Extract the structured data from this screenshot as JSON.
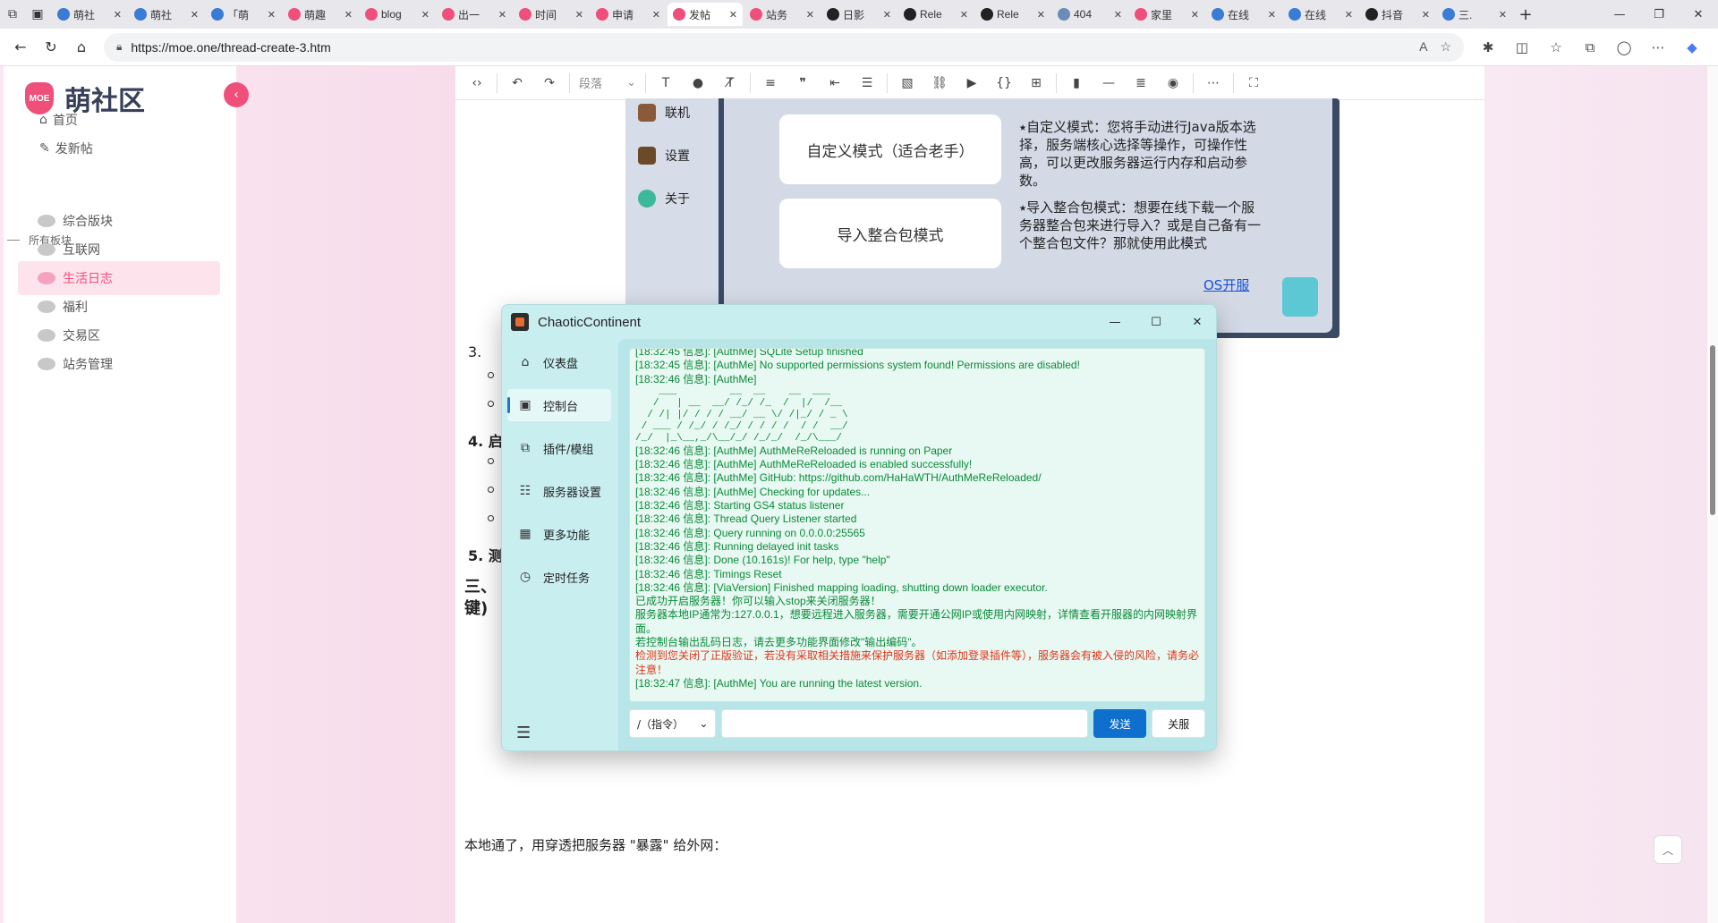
{
  "browser": {
    "tabs": [
      {
        "label": "萌社",
        "color": "#3a7bd5"
      },
      {
        "label": "萌社",
        "color": "#3a7bd5"
      },
      {
        "label": "「萌",
        "color": "#3a7bd5"
      },
      {
        "label": "萌趣",
        "color": "#ef4f7b"
      },
      {
        "label": "blog",
        "color": "#ef4f7b"
      },
      {
        "label": "出一",
        "color": "#ef4f7b"
      },
      {
        "label": "时间",
        "color": "#ef4f7b"
      },
      {
        "label": "申请",
        "color": "#ef4f7b"
      },
      {
        "label": "发帖",
        "color": "#ef4f7b",
        "active": true
      },
      {
        "label": "站务",
        "color": "#ef4f7b"
      },
      {
        "label": "日影",
        "color": "#222222"
      },
      {
        "label": "Rele",
        "color": "#222222"
      },
      {
        "label": "Rele",
        "color": "#222222"
      },
      {
        "label": "404",
        "color": "#6b8cb8"
      },
      {
        "label": "家里",
        "color": "#ef4f7b"
      },
      {
        "label": "在线",
        "color": "#3a7bd5"
      },
      {
        "label": "在线",
        "color": "#3a7bd5"
      },
      {
        "label": "抖音",
        "color": "#222222"
      },
      {
        "label": "三.",
        "color": "#3a7bd5"
      }
    ],
    "url": "https://moe.one/thread-create-3.htm"
  },
  "sidebar": {
    "brand": "萌社区",
    "logo_text": "MOE",
    "links": [
      {
        "label": "首页"
      },
      {
        "label": "发新帖"
      }
    ],
    "section_title": "所有板块",
    "boards": [
      {
        "label": "综合版块"
      },
      {
        "label": "互联网"
      },
      {
        "label": "生活日志",
        "active": true
      },
      {
        "label": "福利"
      },
      {
        "label": "交易区"
      },
      {
        "label": "站务管理"
      }
    ]
  },
  "editor": {
    "toolbar": {
      "paragraph_select": "段落"
    },
    "embed": {
      "nav": [
        "联机",
        "设置",
        "关于"
      ],
      "cards": [
        "自定义模式（适合老手）",
        "导入整合包模式"
      ],
      "desc1": "⭑自定义模式：您将手动进行Java版本选择，服务端核心选择等操作，可操作性高，可以更改服务器运行内存和启动参数。",
      "desc2": "⭑导入整合包模式：想要在线下载一个服务器整合包来进行导入？或是自己备有一个整合包文件？那就使用此模式",
      "link": "OS开服"
    },
    "list_items": [
      "3.",
      "4. 启",
      "5. 测"
    ],
    "heading_fragment_1": "三、",
    "heading_fragment_2": "键)",
    "bottom_text": "本地通了，用穿透把服务器 \"暴露\" 给外网："
  },
  "app": {
    "title": "ChaoticContinent",
    "nav": [
      {
        "label": "仪表盘",
        "icon": "home-icon"
      },
      {
        "label": "控制台",
        "icon": "console-icon",
        "active": true
      },
      {
        "label": "插件/模组",
        "icon": "plugin-icon"
      },
      {
        "label": "服务器设置",
        "icon": "sliders-icon"
      },
      {
        "label": "更多功能",
        "icon": "grid-icon"
      },
      {
        "label": "定时任务",
        "icon": "timer-icon"
      }
    ],
    "console_lines": [
      {
        "t": "[18:32:45 信息]: [AuthMe] SQLite Setup finished",
        "c": "g",
        "cut": true
      },
      {
        "t": "[18:32:45 信息]: [AuthMe] No supported permissions system found! Permissions are disabled!",
        "c": "g"
      },
      {
        "t": "[18:32:46 信息]: [AuthMe]",
        "c": "g"
      },
      {
        "t": "",
        "c": "g"
      },
      {
        "t": "    ___         __  __    __  ___     ",
        "c": "ascii"
      },
      {
        "t": "   /   | __  __/ /_/ /_  /  |/  /__   ",
        "c": "ascii"
      },
      {
        "t": "  / /| |/ / / / __/ __ \\/ /|_/ / _ \\  ",
        "c": "ascii"
      },
      {
        "t": " / ___ / /_/ / /_/ / / / /  / /  __/  ",
        "c": "ascii"
      },
      {
        "t": "/_/  |_\\__,_/\\__/_/ /_/_/  /_/\\___/   ",
        "c": "ascii"
      },
      {
        "t": "[18:32:46 信息]: [AuthMe] AuthMeReReloaded is running on Paper",
        "c": "g"
      },
      {
        "t": "[18:32:46 信息]: [AuthMe] AuthMeReReloaded is enabled successfully!",
        "c": "g"
      },
      {
        "t": "[18:32:46 信息]: [AuthMe] GitHub: https://github.com/HaHaWTH/AuthMeReReloaded/",
        "c": "g"
      },
      {
        "t": "[18:32:46 信息]: [AuthMe] Checking for updates...",
        "c": "g"
      },
      {
        "t": "[18:32:46 信息]: Starting GS4 status listener",
        "c": "g"
      },
      {
        "t": "[18:32:46 信息]: Thread Query Listener started",
        "c": "g"
      },
      {
        "t": "[18:32:46 信息]: Query running on 0.0.0.0:25565",
        "c": "g"
      },
      {
        "t": "[18:32:46 信息]: Running delayed init tasks",
        "c": "g"
      },
      {
        "t": "[18:32:46 信息]: Done (10.161s)! For help, type \"help\"",
        "c": "g"
      },
      {
        "t": "[18:32:46 信息]: Timings Reset",
        "c": "g"
      },
      {
        "t": "[18:32:46 信息]: [ViaVersion] Finished mapping loading, shutting down loader executor.",
        "c": "g"
      },
      {
        "t": "已成功开启服务器！你可以输入stop来关闭服务器！",
        "c": "g"
      },
      {
        "t": "服务器本地IP通常为:127.0.0.1，想要远程进入服务器，需要开通公网IP或使用内网映射，详情查看开服器的内网映射界面。",
        "c": "g"
      },
      {
        "t": "若控制台输出乱码日志，请去更多功能界面修改\"输出编码\"。",
        "c": "g"
      },
      {
        "t": "检测到您关闭了正版验证，若没有采取相关措施来保护服务器（如添加登录插件等），服务器会有被入侵的风险，请务必注意！",
        "c": "r"
      },
      {
        "t": "[18:32:47 信息]: [AuthMe] You are running the latest version.",
        "c": "g"
      }
    ],
    "command_select": "/（指令）",
    "command_input": "",
    "send_label": "发送",
    "stop_label": "关服"
  }
}
